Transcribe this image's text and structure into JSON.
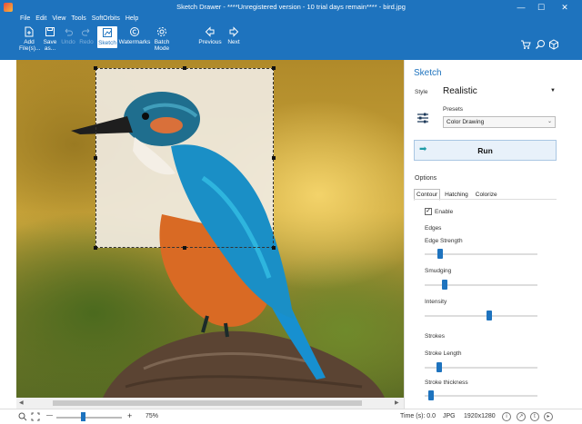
{
  "window": {
    "title": "Sketch Drawer - ****Unregistered version - 10 trial days remain**** - bird.jpg",
    "controls": {
      "minimize": "—",
      "maximize": "☐",
      "close": "✕"
    }
  },
  "menu": {
    "items": [
      "File",
      "Edit",
      "View",
      "Tools",
      "SoftOrbits",
      "Help"
    ]
  },
  "toolbar": {
    "add_files_label": "Add File(s)...",
    "save_as_label": "Save as...",
    "undo_label": "Undo",
    "redo_label": "Redo",
    "sketch_label": "Sketch",
    "watermarks_label": "Watermarks",
    "batch_mode_label": "Batch Mode",
    "previous_label": "Previous",
    "next_label": "Next",
    "right_icons": [
      "cart-icon",
      "search-icon",
      "cube-icon"
    ]
  },
  "panel": {
    "title": "Sketch",
    "style_label": "Style",
    "style_value": "Realistic",
    "presets_label": "Presets",
    "presets_value": "Color Drawing",
    "run_label": "Run",
    "options_label": "Options",
    "tabs": [
      {
        "label": "Contour",
        "active": true
      },
      {
        "label": "Hatching",
        "active": false
      },
      {
        "label": "Colorize",
        "active": false
      }
    ],
    "enable_label": "Enable",
    "enable_checked": true,
    "edges_heading": "Edges",
    "strokes_heading": "Strokes",
    "sliders": {
      "edge_strength": {
        "label": "Edge Strength",
        "value": 0.12
      },
      "smudging": {
        "label": "Smudging",
        "value": 0.16
      },
      "intensity": {
        "label": "Intensity",
        "value": 0.58
      },
      "stroke_length": {
        "label": "Stroke Length",
        "value": 0.11
      },
      "stroke_thickness": {
        "label": "Stroke thickness",
        "value": 0.03
      }
    }
  },
  "status": {
    "zoom_percent": "75%",
    "zoom_minus": "—",
    "zoom_plus": "+",
    "zoom_level": 0.4,
    "time": "Time (s): 0.0",
    "format": "JPG",
    "dimensions": "1920x1280"
  },
  "colors": {
    "accent": "#1e73be",
    "run_bg": "#e8f1fa",
    "slider": "#1e73be"
  }
}
